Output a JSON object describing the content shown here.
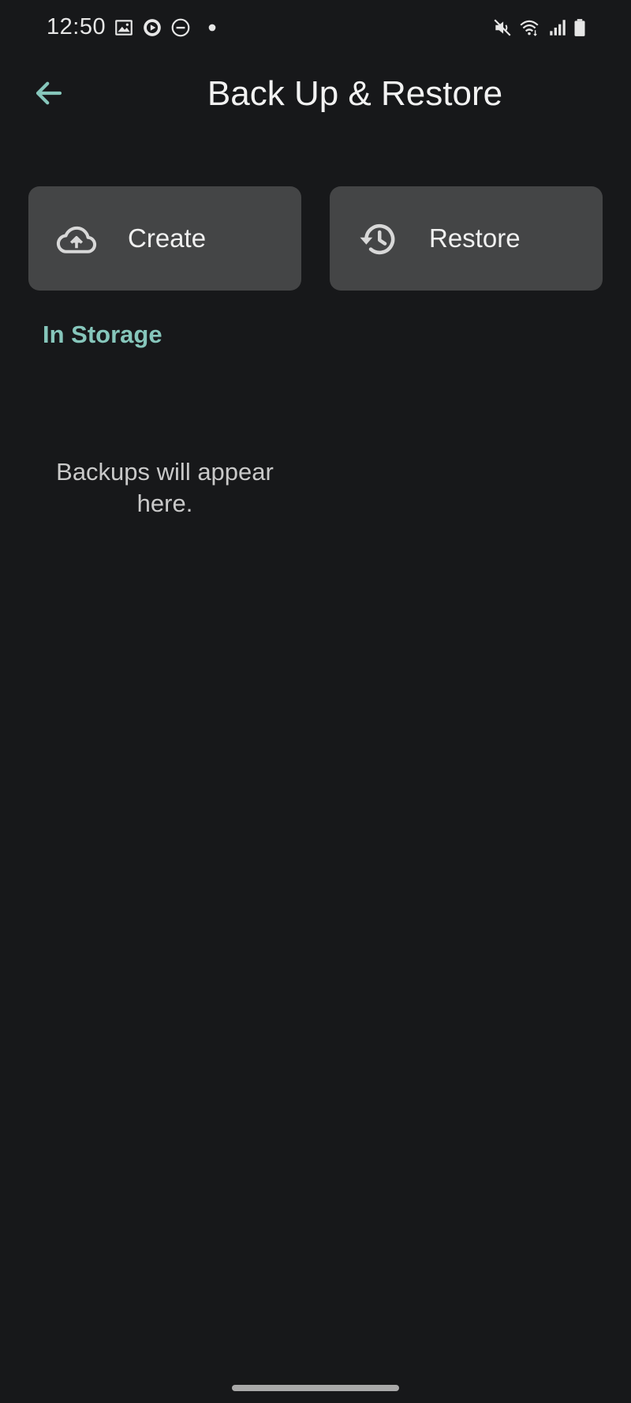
{
  "status_bar": {
    "time": "12:50",
    "left_icons": [
      "gallery-icon",
      "media-icon",
      "do-not-disturb-icon",
      "notification-dot-icon"
    ],
    "right_icons": [
      "mute-icon",
      "wifi-icon",
      "signal-icon",
      "battery-icon"
    ]
  },
  "header": {
    "back_icon": "arrow-back-icon",
    "title": "Back Up & Restore"
  },
  "actions": [
    {
      "label": "Create",
      "icon": "cloud-upload-icon"
    },
    {
      "label": "Restore",
      "icon": "history-icon"
    }
  ],
  "storage": {
    "section_title": "In Storage",
    "empty_message": "Backups will appear here."
  },
  "colors": {
    "background": "#17181a",
    "card": "#444546",
    "accent": "#86c6bb",
    "text": "#f0f0f0"
  }
}
